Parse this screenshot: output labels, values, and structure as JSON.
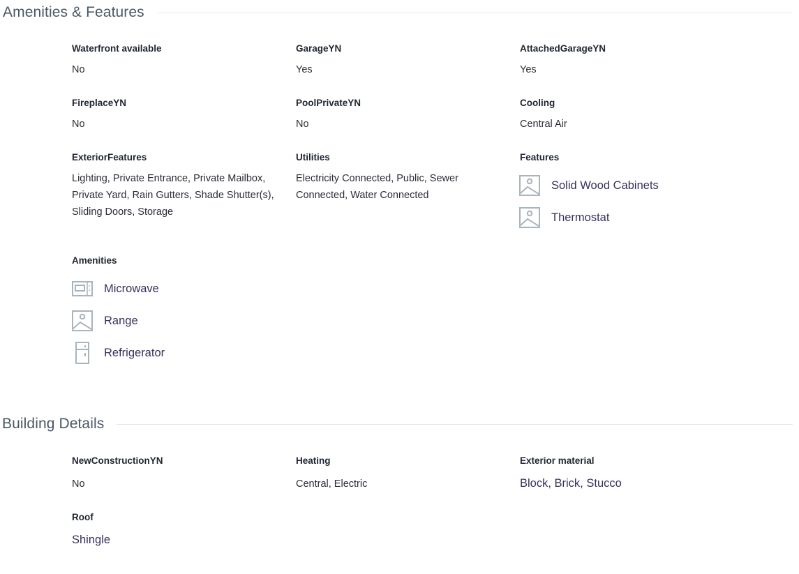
{
  "amenities_section": {
    "title": "Amenities & Features",
    "fields": {
      "waterfront": {
        "label": "Waterfront available",
        "value": "No"
      },
      "garage": {
        "label": "GarageYN",
        "value": "Yes"
      },
      "attached_garage": {
        "label": "AttachedGarageYN",
        "value": "Yes"
      },
      "fireplace": {
        "label": "FireplaceYN",
        "value": "No"
      },
      "pool_private": {
        "label": "PoolPrivateYN",
        "value": "No"
      },
      "cooling": {
        "label": "Cooling",
        "value": "Central Air"
      },
      "exterior_features": {
        "label": "ExteriorFeatures",
        "value": "Lighting, Private Entrance, Private Mailbox, Private Yard, Rain Gutters, Shade Shutter(s), Sliding Doors, Storage"
      },
      "utilities": {
        "label": "Utilities",
        "value": "Electricity Connected, Public, Sewer Connected, Water Connected"
      }
    },
    "features": {
      "label": "Features",
      "items": [
        {
          "text": "Solid Wood Cabinets",
          "icon": "image-placeholder-icon"
        },
        {
          "text": "Thermostat",
          "icon": "image-placeholder-icon"
        }
      ]
    },
    "amenities": {
      "label": "Amenities",
      "items": [
        {
          "text": "Microwave",
          "icon": "microwave-icon"
        },
        {
          "text": "Range",
          "icon": "image-placeholder-icon"
        },
        {
          "text": "Refrigerator",
          "icon": "refrigerator-icon"
        }
      ]
    }
  },
  "building_section": {
    "title": "Building Details",
    "fields": {
      "new_construction": {
        "label": "NewConstructionYN",
        "value": "No"
      },
      "heating": {
        "label": "Heating",
        "value": "Central, Electric"
      },
      "exterior_material": {
        "label": "Exterior material",
        "value": "Block, Brick, Stucco"
      },
      "roof": {
        "label": "Roof",
        "value": "Shingle"
      }
    }
  },
  "colors": {
    "icon_stroke": "#a9b4bb",
    "link_text": "#3b2f5b",
    "rule": "#e4e7ea"
  }
}
